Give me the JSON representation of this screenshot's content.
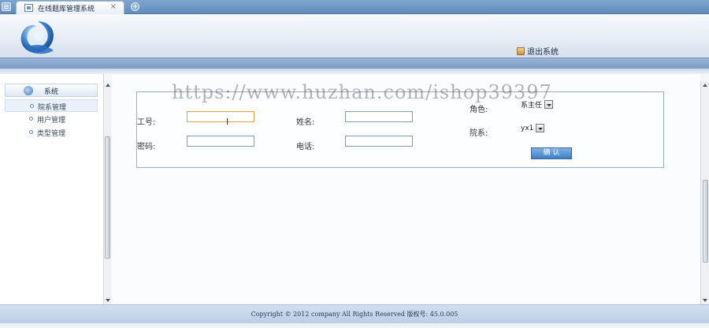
{
  "tabbar": {
    "tab_label": "在线题库管理系统",
    "close_glyph": "×",
    "add_glyph": "+"
  },
  "header": {
    "logout_label": "退出系统"
  },
  "sidebar": {
    "section_label": "系统",
    "items": [
      {
        "label": "院系管理"
      },
      {
        "label": "用户管理"
      },
      {
        "label": "类型管理"
      }
    ]
  },
  "form": {
    "job_no_label": "工号:",
    "name_label": "姓名:",
    "password_label": "密码:",
    "phone_label": "电话:",
    "role_label": "角色:",
    "role_value": "系主任",
    "dept_label": "院系:",
    "dept_value": "yx1",
    "confirm_label": "确 认"
  },
  "footer": {
    "copyright": "Copyright © 2012 company All Rights Reserved  版权号: 45.0.005"
  },
  "watermark": "https://www.huzhan.com/ishop39397",
  "colors": {
    "accent": "#3f7fc1",
    "tabbar": "#6f98c6",
    "focus": "#e2a23a"
  }
}
